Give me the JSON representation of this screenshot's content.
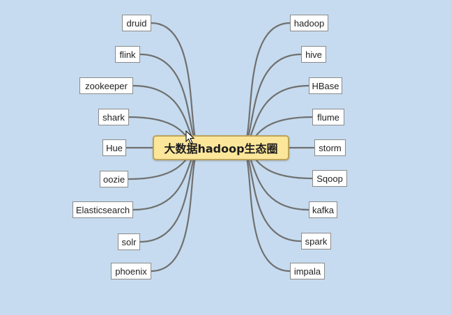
{
  "diagram": {
    "central_topic": "大数据hadoop生态圈",
    "left_branches": [
      "druid",
      "flink",
      "zookeeper",
      "shark",
      "Hue",
      "oozie",
      "Elasticsearch",
      "solr",
      "phoenix"
    ],
    "right_branches": [
      "hadoop",
      "hive",
      "HBase",
      "flume",
      "storm",
      "Sqoop",
      "kafka",
      "spark",
      "impala"
    ]
  },
  "colors": {
    "background": "#c6dbef",
    "central_fill": "#fbe69a",
    "central_border": "#bba45a",
    "node_fill": "#ffffff",
    "node_border": "#8a8a8a",
    "connector": "#707070"
  },
  "icons": {
    "cursor": "mouse-pointer-icon"
  }
}
